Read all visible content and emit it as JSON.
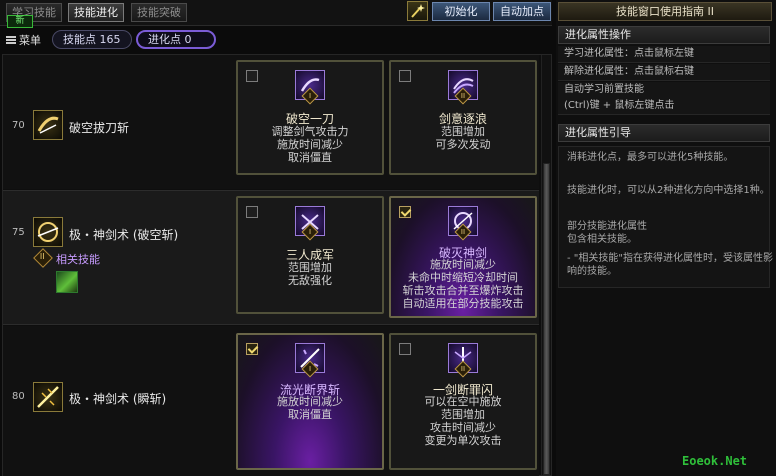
{
  "tabs": [
    {
      "label": "学习技能",
      "active": false
    },
    {
      "label": "技能进化",
      "active": true
    },
    {
      "label": "技能突破",
      "active": false
    }
  ],
  "new_badge": "新",
  "buttons": {
    "reset": "初始化",
    "auto_add": "自动加点"
  },
  "menu_label": "菜单",
  "skill_points": "技能点 165",
  "evo_points": "进化点 0",
  "skills": [
    {
      "level": "70",
      "name": "破空拔刀斩",
      "evolutions": [
        {
          "title": "破空一刀",
          "desc": [
            "调整剑气攻击力",
            "施放时间减少",
            "取消僵直"
          ],
          "checked": false,
          "selected": false,
          "num": "I"
        },
        {
          "title": "剑意逐浪",
          "desc": [
            "范围增加",
            "可多次发动"
          ],
          "checked": false,
          "selected": false,
          "num": "II"
        }
      ]
    },
    {
      "level": "75",
      "name": "极・神剑术 (破空斩)",
      "related_label": "相关技能",
      "evolutions": [
        {
          "title": "三人成军",
          "desc": [
            "范围增加",
            "无敌强化"
          ],
          "checked": false,
          "selected": false,
          "num": "I"
        },
        {
          "title": "破灭神剑",
          "desc": [
            "施放时间减少",
            "未命中时缩短冷却时间",
            "斩击攻击合并至爆炸攻击",
            "自动适用在部分技能攻击"
          ],
          "checked": true,
          "selected": true,
          "num": "II"
        }
      ]
    },
    {
      "level": "80",
      "name": "极・神剑术 (瞬斩)",
      "evolutions": [
        {
          "title": "流光断界斩",
          "desc": [
            "施放时间减少",
            "取消僵直"
          ],
          "checked": true,
          "selected": true,
          "num": "I"
        },
        {
          "title": "一剑断罪闪",
          "desc": [
            "可以在空中施放",
            "范围增加",
            "攻击时间减少",
            "变更为单次攻击"
          ],
          "checked": false,
          "selected": false,
          "num": "II"
        }
      ]
    }
  ],
  "guide": {
    "title": "技能窗口使用指南 II",
    "section1_title": "进化属性操作",
    "line1": "学习进化属性：点击鼠标左键",
    "line2": "解除进化属性：点击鼠标右键",
    "line3a": "自动学习前置技能",
    "line3b": "(Ctrl)键 + 鼠标左键点击",
    "section2_title": "进化属性引导",
    "p1": "消耗进化点，最多可以进化5种技能。",
    "p2": "技能进化时，可以从2种进化方向中选择1种。",
    "p3a": "部分技能进化属性",
    "p3b": "包含相关技能。",
    "p4": "- \"相关技能\"指在获得进化属性时，受该属性影响的技能。"
  },
  "watermark": "Eoeok.Net"
}
